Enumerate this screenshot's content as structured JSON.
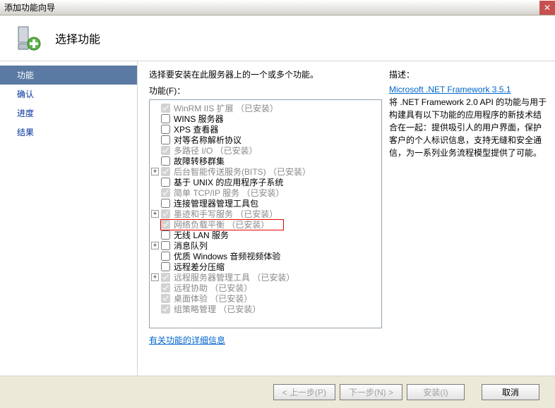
{
  "window": {
    "title": "添加功能向导"
  },
  "header": {
    "title": "选择功能"
  },
  "sidebar": {
    "items": [
      {
        "label": "功能",
        "selected": true
      },
      {
        "label": "确认"
      },
      {
        "label": "进度"
      },
      {
        "label": "结果"
      }
    ]
  },
  "main": {
    "instruction": "选择要安装在此服务器上的一个或多个功能。",
    "features_label": "功能(F)：",
    "detail_link": "有关功能的详细信息",
    "tree": [
      {
        "indent": 1,
        "checked": true,
        "disabled": true,
        "label": "WinRM IIS 扩展  （已安装）"
      },
      {
        "indent": 1,
        "checked": false,
        "disabled": false,
        "label": "WINS 服务器"
      },
      {
        "indent": 1,
        "checked": false,
        "disabled": false,
        "label": "XPS 查看器"
      },
      {
        "indent": 1,
        "checked": false,
        "disabled": false,
        "label": "对等名称解析协议"
      },
      {
        "indent": 1,
        "checked": true,
        "disabled": true,
        "label": "多路径 I/O  （已安装）"
      },
      {
        "indent": 1,
        "checked": false,
        "disabled": false,
        "label": "故障转移群集"
      },
      {
        "indent": 0,
        "expand": "+",
        "checked": true,
        "disabled": true,
        "label": "后台智能传送服务(BITS)  （已安装）"
      },
      {
        "indent": 1,
        "checked": false,
        "disabled": false,
        "label": "基于 UNIX 的应用程序子系统"
      },
      {
        "indent": 1,
        "checked": true,
        "disabled": true,
        "label": "简单 TCP/IP 服务  （已安装）"
      },
      {
        "indent": 1,
        "checked": false,
        "disabled": false,
        "label": "连接管理器管理工具包"
      },
      {
        "indent": 0,
        "expand": "+",
        "checked": true,
        "disabled": true,
        "label": "墨迹和手写服务  （已安装）"
      },
      {
        "indent": 1,
        "checked": true,
        "disabled": true,
        "label": "网络负载平衡  （已安装）",
        "highlighted": true
      },
      {
        "indent": 1,
        "checked": false,
        "disabled": false,
        "label": "无线 LAN 服务"
      },
      {
        "indent": 0,
        "expand": "+",
        "checked": false,
        "disabled": false,
        "label": "消息队列"
      },
      {
        "indent": 1,
        "checked": false,
        "disabled": false,
        "label": "优质 Windows 音频视频体验"
      },
      {
        "indent": 1,
        "checked": false,
        "disabled": false,
        "label": "远程差分压缩"
      },
      {
        "indent": 0,
        "expand": "+",
        "checked": true,
        "disabled": true,
        "label": "远程服务器管理工具  （已安装）"
      },
      {
        "indent": 1,
        "checked": true,
        "disabled": true,
        "label": "远程协助  （已安装）"
      },
      {
        "indent": 1,
        "checked": true,
        "disabled": true,
        "label": "桌面体验  （已安装）"
      },
      {
        "indent": 1,
        "checked": true,
        "disabled": true,
        "label": "组策略管理  （已安装）"
      }
    ]
  },
  "description": {
    "title": "描述：",
    "link": "Microsoft .NET Framework 3.5.1",
    "text": "将 .NET Framework 2.0 API 的功能与用于构建具有以下功能的应用程序的新技术结合在一起：提供吸引人的用户界面，保护客户的个人标识信息，支持无缝和安全通信，为一系列业务流程模型提供了可能。"
  },
  "footer": {
    "prev": "< 上一步(P)",
    "next": "下一步(N) >",
    "install": "安装(I)",
    "cancel": "取消"
  }
}
